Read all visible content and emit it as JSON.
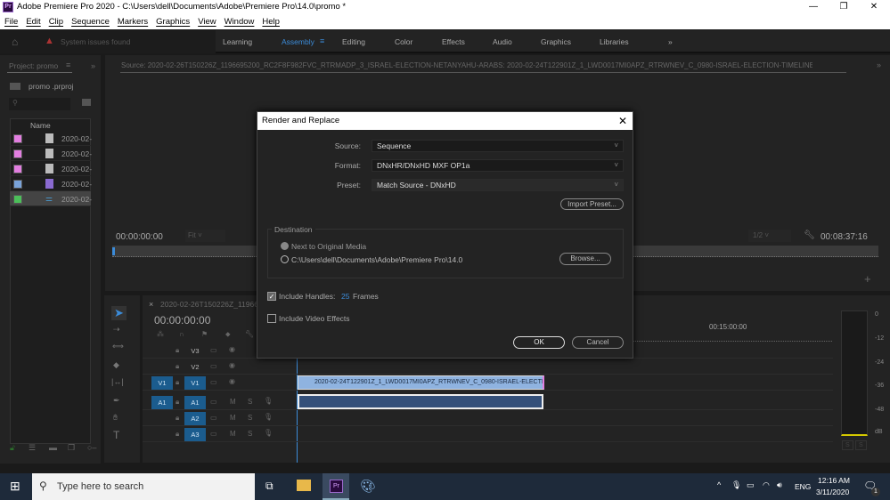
{
  "window": {
    "title": "Adobe Premiere Pro 2020 - C:\\Users\\dell\\Documents\\Adobe\\Premiere Pro\\14.0\\promo  *",
    "app_icon": "Pr"
  },
  "menu": [
    "File",
    "Edit",
    "Clip",
    "Sequence",
    "Markers",
    "Graphics",
    "View",
    "Window",
    "Help"
  ],
  "workspace": {
    "warning": "System issues found",
    "tabs": [
      "Learning",
      "Assembly",
      "Editing",
      "Color",
      "Effects",
      "Audio",
      "Graphics",
      "Libraries"
    ],
    "active": "Assembly"
  },
  "project": {
    "tab": "Project: promo",
    "file": "promo .prproj",
    "column": "Name",
    "items": [
      {
        "name": "2020-02-",
        "color": "#e27ee0"
      },
      {
        "name": "2020-02-",
        "color": "#e27ee0"
      },
      {
        "name": "2020-02-",
        "color": "#e27ee0"
      },
      {
        "name": "2020-02-",
        "color": "#7aa3d9"
      },
      {
        "name": "2020-02-",
        "color": "#4cbf5a"
      }
    ]
  },
  "source": {
    "tab": "Source: 2020-02-26T150226Z_1196695200_RC2F8F982FVC_RTRMADP_3_ISRAEL-ELECTION-NETANYAHU-ARABS: 2020-02-24T122901Z_1_LWD0017MI0APZ_RTRWNEV_C_0980-ISRAEL-ELECTION-TIMELINE.MP4: 00:00:00:00",
    "timecode": "00:00:00:00",
    "fit": "Fit",
    "resolution": "1/2",
    "duration": "00:08:37:16"
  },
  "timeline": {
    "tab": "2020-02-26T150226Z_119669",
    "timecode": "00:00:00:00",
    "ruler_label": "00:15:00:00",
    "video_tracks": [
      "V3",
      "V2",
      "V1"
    ],
    "audio_tracks": [
      "A1",
      "A2",
      "A3"
    ],
    "source_v": "V1",
    "source_a": "A1",
    "clip": "2020-02-24T122901Z_1_LWD0017MI0APZ_RTRWNEV_C_0980-ISRAEL-ELECTION-TI",
    "m": "M",
    "s": "S"
  },
  "meters": {
    "scale": [
      "0",
      "-12",
      "-24",
      "-36",
      "-48",
      "dB"
    ],
    "solo": [
      "S",
      "S"
    ]
  },
  "dialog": {
    "title": "Render and Replace",
    "source_label": "Source:",
    "source_value": "Sequence",
    "format_label": "Format:",
    "format_value": "DNxHR/DNxHD MXF OP1a",
    "preset_label": "Preset:",
    "preset_value": "Match Source - DNxHD",
    "import_preset": "Import Preset...",
    "destination": "Destination",
    "next_to_original": "Next to Original Media",
    "path": "C:\\Users\\dell\\Documents\\Adobe\\Premiere Pro\\14.0",
    "browse": "Browse...",
    "include_handles": "Include Handles:",
    "handles_value": "25",
    "frames": "Frames",
    "include_handles_checked": true,
    "include_video_effects": "Include Video Effects",
    "include_video_effects_checked": false,
    "ok": "OK",
    "cancel": "Cancel"
  },
  "taskbar": {
    "search_placeholder": "Type here to search",
    "language": "ENG",
    "time": "12:16 AM",
    "date": "3/11/2020",
    "notifications": "1"
  }
}
